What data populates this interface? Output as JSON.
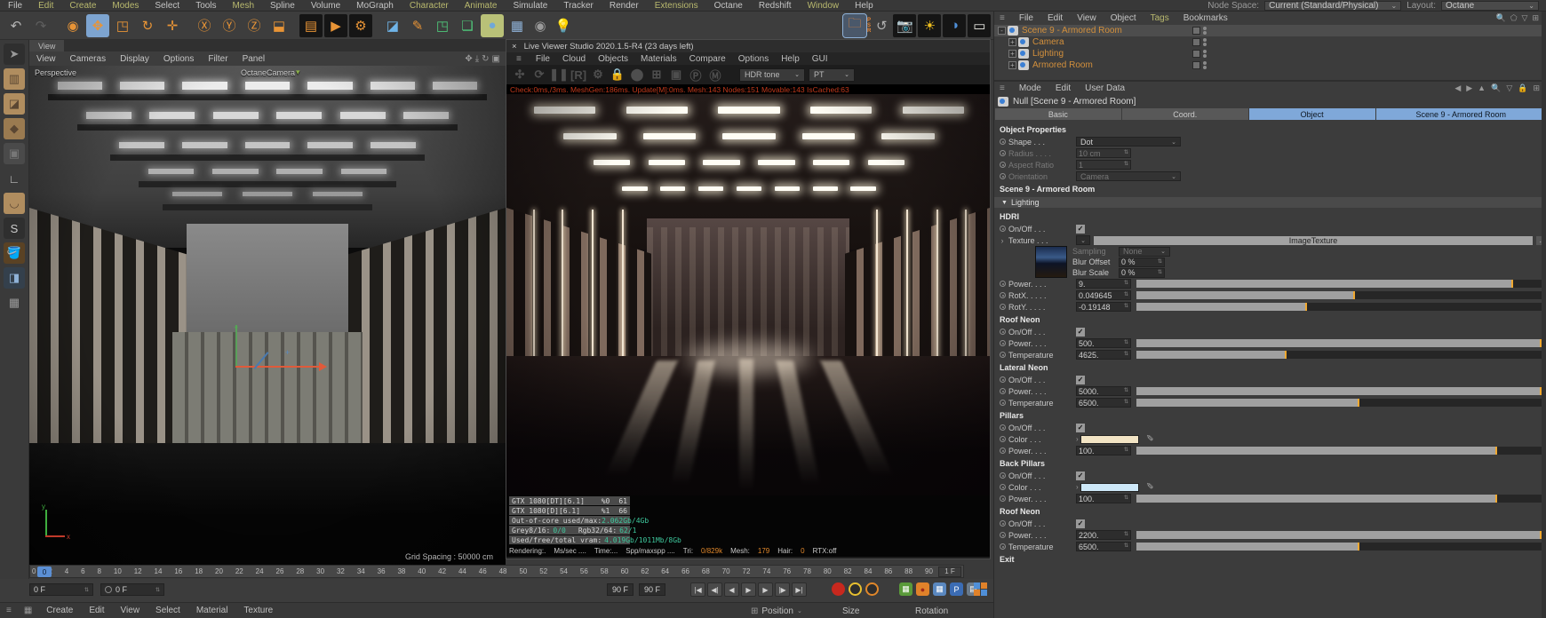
{
  "menu_bar": {
    "items": [
      {
        "label": "File",
        "accent": false
      },
      {
        "label": "Edit",
        "accent": true
      },
      {
        "label": "Create",
        "accent": true
      },
      {
        "label": "Modes",
        "accent": true
      },
      {
        "label": "Select",
        "accent": false
      },
      {
        "label": "Tools",
        "accent": false
      },
      {
        "label": "Mesh",
        "accent": true
      },
      {
        "label": "Spline",
        "accent": false
      },
      {
        "label": "Volume",
        "accent": false
      },
      {
        "label": "MoGraph",
        "accent": false
      },
      {
        "label": "Character",
        "accent": true
      },
      {
        "label": "Animate",
        "accent": true
      },
      {
        "label": "Simulate",
        "accent": false
      },
      {
        "label": "Tracker",
        "accent": false
      },
      {
        "label": "Render",
        "accent": false
      },
      {
        "label": "Extensions",
        "accent": true
      },
      {
        "label": "Octane",
        "accent": false
      },
      {
        "label": "Redshift",
        "accent": false
      },
      {
        "label": "Window",
        "accent": true
      },
      {
        "label": "Help",
        "accent": false
      }
    ],
    "node_space_label": "Node Space:",
    "node_space_value": "Current (Standard/Physical)",
    "layout_label": "Layout:",
    "layout_value": "Octane"
  },
  "toolbar_icons": [
    {
      "name": "undo-icon",
      "glyph": "↶",
      "fg": "#b5b5b5",
      "cls": ""
    },
    {
      "name": "redo-icon",
      "glyph": "↷",
      "fg": "#5e5e5e",
      "cls": ""
    },
    {
      "name": "sep",
      "glyph": "",
      "fg": "",
      "cls": "sep"
    },
    {
      "name": "live-selection-icon",
      "glyph": "◉",
      "fg": "#e89436",
      "cls": ""
    },
    {
      "name": "move-tool-icon",
      "glyph": "✥",
      "fg": "#e89436",
      "cls": "sel"
    },
    {
      "name": "scale-tool-icon",
      "glyph": "◳",
      "fg": "#e89436",
      "cls": ""
    },
    {
      "name": "rotate-tool-icon",
      "glyph": "↻",
      "fg": "#e89436",
      "cls": ""
    },
    {
      "name": "last-tool-icon",
      "glyph": "✛",
      "fg": "#e89436",
      "cls": ""
    },
    {
      "name": "sep",
      "glyph": "",
      "fg": "",
      "cls": "sep"
    },
    {
      "name": "lock-x-axis-icon",
      "glyph": "Ⓧ",
      "fg": "#e89436",
      "cls": ""
    },
    {
      "name": "lock-y-axis-icon",
      "glyph": "Ⓨ",
      "fg": "#e89436",
      "cls": ""
    },
    {
      "name": "lock-z-axis-icon",
      "glyph": "Ⓩ",
      "fg": "#e89436",
      "cls": ""
    },
    {
      "name": "coordinate-system-icon",
      "glyph": "⬓",
      "fg": "#e89436",
      "cls": ""
    },
    {
      "name": "sep",
      "glyph": "",
      "fg": "",
      "cls": "sep"
    },
    {
      "name": "render-view-icon",
      "glyph": "▤",
      "fg": "#e89436",
      "cls": "box"
    },
    {
      "name": "render-picture-viewer-icon",
      "glyph": "▶",
      "fg": "#e89436",
      "cls": "box"
    },
    {
      "name": "render-settings-icon",
      "glyph": "⚙",
      "fg": "#e89436",
      "cls": "box"
    },
    {
      "name": "sep",
      "glyph": "",
      "fg": "",
      "cls": "sep"
    },
    {
      "name": "add-cube-icon",
      "glyph": "◪",
      "fg": "#6fb4e8",
      "cls": ""
    },
    {
      "name": "add-spline-icon",
      "glyph": "✎",
      "fg": "#e89436",
      "cls": ""
    },
    {
      "name": "add-generator-icon",
      "glyph": "◳",
      "fg": "#4fc87a",
      "cls": ""
    },
    {
      "name": "add-deformer-icon",
      "glyph": "❏",
      "fg": "#4fc87a",
      "cls": ""
    },
    {
      "name": "add-environment-icon",
      "glyph": "●",
      "fg": "#6fa8d8",
      "cls": "sel2"
    },
    {
      "name": "add-landscape-icon",
      "glyph": "▦",
      "fg": "#8fb2d8",
      "cls": ""
    },
    {
      "name": "add-camera-icon",
      "glyph": "◉",
      "fg": "#9a9a9a",
      "cls": "small"
    },
    {
      "name": "add-light-icon",
      "glyph": "💡",
      "fg": "#d8d8d8",
      "cls": ""
    },
    {
      "name": "gap300",
      "glyph": "",
      "fg": "",
      "cls": "gap"
    },
    {
      "name": "octane-folder-icon",
      "glyph": "🗀",
      "fg": "#e8883a",
      "cls": "frame"
    },
    {
      "name": "octane-psr-reset-icon",
      "glyph": "PSR",
      "fg": "#e8883a",
      "cls": "psr"
    },
    {
      "name": "octane-reset-icon",
      "glyph": "↺",
      "fg": "#b0b0b0",
      "cls": "small"
    },
    {
      "name": "octane-camera-icon",
      "glyph": "📷",
      "fg": "#d83020",
      "cls": "box"
    },
    {
      "name": "octane-sun-icon",
      "glyph": "☀",
      "fg": "#f0c020",
      "cls": "box"
    },
    {
      "name": "octane-daylight-icon",
      "glyph": "◑",
      "fg": "#4f8fd8",
      "cls": "box"
    },
    {
      "name": "octane-arealight-icon",
      "glyph": "▭",
      "fg": "#f0f0e8",
      "cls": "box"
    },
    {
      "name": "octane-mix-material-icon",
      "glyph": "◍",
      "fg": "#b8c4d0",
      "cls": ""
    },
    {
      "name": "octane-material-icon",
      "glyph": "●",
      "fg": "#b8c4d0",
      "cls": ""
    },
    {
      "name": "octane-shuriken-icon",
      "glyph": "✣",
      "fg": "#3a3a3a",
      "cls": ""
    },
    {
      "name": "octane-pause-icon",
      "glyph": "❚❚",
      "fg": "#2f2f2f",
      "cls": ""
    }
  ],
  "left_palette": [
    {
      "name": "pen-tool-icon",
      "glyph": "➤",
      "fg": "#9a9a9a",
      "bg": "#2f2f2f"
    },
    {
      "name": "modeling-tool-1-icon",
      "glyph": "▥",
      "fg": "#5a4632",
      "bg": "#b08d5f"
    },
    {
      "name": "modeling-tool-2-icon",
      "glyph": "◪",
      "fg": "#5a4632",
      "bg": "#b08d5f"
    },
    {
      "name": "modeling-tool-3-icon",
      "glyph": "◆",
      "fg": "#5a4632",
      "bg": "#9a7a50"
    },
    {
      "name": "modeling-tool-4-icon",
      "glyph": "▣",
      "fg": "#777",
      "bg": "#4a4a4a"
    },
    {
      "name": "axis-tool-icon",
      "glyph": "∟",
      "fg": "#c0c0c0",
      "bg": "#3a3a3a"
    },
    {
      "name": "magnet-tool-icon",
      "glyph": "◡",
      "fg": "#5a4632",
      "bg": "#b08d5f"
    },
    {
      "name": "snap-tool-icon",
      "glyph": "S",
      "fg": "#ccc",
      "bg": "#2f2f2f"
    },
    {
      "name": "paint-tool-icon",
      "glyph": "🪣",
      "fg": "#e8883a",
      "bg": "#5a4224"
    },
    {
      "name": "texture-tool-icon",
      "glyph": "◨",
      "fg": "#8fb2d8",
      "bg": "#34404c"
    },
    {
      "name": "uv-tool-icon",
      "glyph": "▦",
      "fg": "#9a9a9a",
      "bg": "#3a3a3a"
    }
  ],
  "viewport": {
    "tab": "View",
    "menu": [
      "View",
      "Cameras",
      "Display",
      "Options",
      "Filter",
      "Panel"
    ],
    "nav_icons": [
      {
        "name": "pan-view-icon",
        "glyph": "✥"
      },
      {
        "name": "zoom-view-icon",
        "glyph": "⤓"
      },
      {
        "name": "rotate-view-icon",
        "glyph": "↻"
      },
      {
        "name": "toggle-view-icon",
        "glyph": "▣"
      }
    ],
    "projection_label": "Perspective",
    "camera_label": "OctaneCamera",
    "grid_spacing": "Grid Spacing : 50000 cm"
  },
  "live_viewer": {
    "close_glyph": "×",
    "title": "Live Viewer Studio 2020.1.5-R4 (23 days left)",
    "menu": [
      "File",
      "Cloud",
      "Objects",
      "Materials",
      "Compare",
      "Options",
      "Help",
      "GUI"
    ],
    "tool_icons": [
      {
        "name": "octane-kernel-icon",
        "glyph": "✣"
      },
      {
        "name": "restart-render-icon",
        "glyph": "⟳"
      },
      {
        "name": "pause-render-icon",
        "glyph": "❚❚"
      },
      {
        "name": "region-render-icon",
        "glyph": "[R]"
      },
      {
        "name": "render-settings-icon",
        "glyph": "⚙"
      },
      {
        "name": "lock-resolution-icon",
        "glyph": "🔒"
      },
      {
        "name": "film-settings-icon",
        "glyph": "⬤"
      },
      {
        "name": "picture-crop-icon",
        "glyph": "⊞"
      },
      {
        "name": "camera-snapshot-icon",
        "glyph": "▣"
      },
      {
        "name": "pick-focus-icon",
        "glyph": "Ⓟ"
      },
      {
        "name": "pick-material-icon",
        "glyph": "Ⓜ"
      }
    ],
    "hdr_tone_value": "HDR tone",
    "kernel_value": "PT",
    "stats_line": "Check:0ms,/3ms. MeshGen:186ms. Update[M]:0ms. Mesh:143 Nodes:151 Movable:143 IsCached:63",
    "gpu_table": [
      {
        "name": "GTX 1080[DT][6.1]",
        "pct": "%0",
        "temp": "61"
      },
      {
        "name": "GTX 1080[D][6.1]",
        "pct": "%1",
        "temp": "66"
      }
    ],
    "out_of_core_label": "Out-of-core used/max:",
    "out_of_core_value": "2.062Gb/4Gb",
    "grey_label": "Grey8/16:",
    "grey_value": "0/0",
    "rgb_label": "Rgb32/64:",
    "rgb_value": "62/1",
    "vram_label": "Used/free/total vram:",
    "vram_value": "4.019Gb/1011Mb/8Gb",
    "status_segments": [
      {
        "t": "Rendering:.",
        "c": "w"
      },
      {
        "t": "Ms/sec ....",
        "c": "w"
      },
      {
        "t": "Time:...",
        "c": "w"
      },
      {
        "t": "Spp/maxspp ....",
        "c": "w"
      },
      {
        "t": "Tri:",
        "c": "w"
      },
      {
        "t": "0/829k",
        "c": "o"
      },
      {
        "t": "Mesh:",
        "c": "w"
      },
      {
        "t": "179",
        "c": "o"
      },
      {
        "t": "Hair:",
        "c": "w"
      },
      {
        "t": "0",
        "c": "o"
      },
      {
        "t": "RTX:off",
        "c": "w"
      }
    ]
  },
  "object_manager": {
    "menu": [
      {
        "label": "File",
        "accent": false
      },
      {
        "label": "Edit",
        "accent": false
      },
      {
        "label": "View",
        "accent": false
      },
      {
        "label": "Object",
        "accent": false
      },
      {
        "label": "Tags",
        "accent": true
      },
      {
        "label": "Bookmarks",
        "accent": false
      }
    ],
    "corner_icons": [
      {
        "name": "search-icon",
        "glyph": "🔍"
      },
      {
        "name": "path-icon",
        "glyph": "⬠"
      },
      {
        "name": "filter-icon",
        "glyph": "▽"
      },
      {
        "name": "add-layer-icon",
        "glyph": "⊞"
      }
    ],
    "tree": [
      {
        "label": "Scene 9 - Armored Room",
        "indent": 0,
        "selected": true,
        "expander": "-"
      },
      {
        "label": "Camera",
        "indent": 1,
        "selected": false,
        "expander": "+"
      },
      {
        "label": "Lighting",
        "indent": 1,
        "selected": false,
        "expander": "+"
      },
      {
        "label": "Armored Room",
        "indent": 1,
        "selected": false,
        "expander": "+"
      }
    ]
  },
  "attributes": {
    "menu": [
      "Mode",
      "Edit",
      "User Data"
    ],
    "corner_icons": [
      {
        "name": "back-icon",
        "glyph": "◀"
      },
      {
        "name": "forward-icon",
        "glyph": "▶"
      },
      {
        "name": "up-icon",
        "glyph": "▲"
      },
      {
        "name": "search-icon",
        "glyph": "🔍"
      },
      {
        "name": "filter-icon",
        "glyph": "▽"
      },
      {
        "name": "lock-icon",
        "glyph": "🔒"
      },
      {
        "name": "layout-icon",
        "glyph": "⊞"
      }
    ],
    "title": "Null [Scene 9 - Armored Room]",
    "tabs": [
      {
        "label": "Basic",
        "active": false
      },
      {
        "label": "Coord.",
        "active": false
      },
      {
        "label": "Object",
        "active": true
      },
      {
        "label": "Scene 9 - Armored Room",
        "active": true
      }
    ],
    "object_properties_header": "Object Properties",
    "object_properties": [
      {
        "kind": "dropdown",
        "label": "Shape . . .",
        "value": "Dot",
        "disabled": false
      },
      {
        "kind": "spin",
        "label": "Radius . . . .",
        "value": "10 cm",
        "disabled": true
      },
      {
        "kind": "spin",
        "label": "Aspect Ratio",
        "value": "1",
        "disabled": true
      },
      {
        "kind": "dropdown",
        "label": "Orientation",
        "value": "Camera",
        "disabled": true
      }
    ],
    "scene_header": "Scene 9 - Armored Room",
    "lighting_fold": "Lighting",
    "groups": [
      {
        "name": "HDRI",
        "rows": [
          {
            "kind": "checkbox",
            "label": "On/Off . . .",
            "checked": true
          },
          {
            "kind": "texture",
            "label": "Texture . . .",
            "button": "ImageTexture"
          },
          {
            "kind": "hdri_sub",
            "rows": [
              {
                "kind": "dropdown_s",
                "label": "Sampling",
                "value": "None",
                "disabled": true
              },
              {
                "kind": "spin_s",
                "label": "Blur Offset",
                "value": "0 %"
              },
              {
                "kind": "spin_s",
                "label": "Blur Scale",
                "value": "0 %"
              }
            ]
          },
          {
            "kind": "slider",
            "label": "Power. . . .",
            "value": "9.",
            "frac": 0.93
          },
          {
            "kind": "slider",
            "label": "RotX. . . . .",
            "value": "0.049645",
            "frac": 0.54
          },
          {
            "kind": "slider",
            "label": "RotY. . . . .",
            "value": "-0.19148",
            "frac": 0.42
          }
        ]
      },
      {
        "name": "Roof Neon",
        "rows": [
          {
            "kind": "checkbox",
            "label": "On/Off . . .",
            "checked": true
          },
          {
            "kind": "slider",
            "label": "Power. . . .",
            "value": "500.",
            "frac": 1.0
          },
          {
            "kind": "slider",
            "label": "Temperature",
            "value": "4625.",
            "frac": 0.37
          }
        ]
      },
      {
        "name": "Lateral Neon",
        "rows": [
          {
            "kind": "checkbox",
            "label": "On/Off . . .",
            "checked": true
          },
          {
            "kind": "slider",
            "label": "Power. . . .",
            "value": "5000.",
            "frac": 1.0
          },
          {
            "kind": "slider",
            "label": "Temperature",
            "value": "6500.",
            "frac": 0.55
          }
        ]
      },
      {
        "name": "Pillars",
        "rows": [
          {
            "kind": "checkbox",
            "label": "On/Off . . .",
            "checked": true
          },
          {
            "kind": "color",
            "label": "Color . . .",
            "hex": "#f2e4c4"
          },
          {
            "kind": "slider",
            "label": "Power. . . .",
            "value": "100.",
            "frac": 0.89
          }
        ]
      },
      {
        "name": "Back Pillars",
        "rows": [
          {
            "kind": "checkbox",
            "label": "On/Off . . .",
            "checked": true
          },
          {
            "kind": "color",
            "label": "Color . . .",
            "hex": "#cde8f8"
          },
          {
            "kind": "slider",
            "label": "Power. . . .",
            "value": "100.",
            "frac": 0.89
          }
        ]
      },
      {
        "name": "Roof Neon",
        "rows": [
          {
            "kind": "checkbox",
            "label": "On/Off . . .",
            "checked": true
          },
          {
            "kind": "slider",
            "label": "Power. . . .",
            "value": "2200.",
            "frac": 1.0
          },
          {
            "kind": "slider",
            "label": "Temperature",
            "value": "6500.",
            "frac": 0.55
          }
        ]
      },
      {
        "name": "Exit",
        "rows": []
      }
    ]
  },
  "timeline": {
    "ticks": [
      "0",
      "2",
      "4",
      "6",
      "8",
      "10",
      "12",
      "14",
      "16",
      "18",
      "20",
      "22",
      "24",
      "26",
      "28",
      "30",
      "32",
      "34",
      "36",
      "38",
      "40",
      "42",
      "44",
      "46",
      "48",
      "50",
      "52",
      "54",
      "56",
      "58",
      "60",
      "62",
      "64",
      "66",
      "68",
      "70",
      "72",
      "74",
      "76",
      "78",
      "80",
      "82",
      "84",
      "86",
      "88",
      "90"
    ],
    "playhead": "0",
    "end_box": "1 F"
  },
  "transport": {
    "frame_field_1": "0 F",
    "frame_field_2": "0 F",
    "range_start": "90 F",
    "range_end": "90 F",
    "buttons": [
      {
        "name": "goto-start-button",
        "glyph": "|◀"
      },
      {
        "name": "prev-key-button",
        "glyph": "◀|"
      },
      {
        "name": "prev-frame-button",
        "glyph": "◀"
      },
      {
        "name": "play-button",
        "glyph": "▶"
      },
      {
        "name": "next-frame-button",
        "glyph": "▶"
      },
      {
        "name": "next-key-button",
        "glyph": "|▶"
      },
      {
        "name": "goto-end-button",
        "glyph": "▶|"
      }
    ],
    "record_buttons": [
      {
        "name": "record-keyframe-button",
        "style": "background:#c8281e;"
      },
      {
        "name": "autokey-button",
        "style": "background:#2d2d2d;border:2px solid #e8c030;"
      },
      {
        "name": "keyframe-selection-button",
        "style": "background:#2d2d2d;border:2px solid #e0872a;"
      }
    ],
    "manager_buttons": [
      {
        "name": "simulate-button",
        "glyph": "▦",
        "style": "background:#5a9a3a;"
      },
      {
        "name": "dynamics-button",
        "glyph": "●",
        "style": "background:#e0822a;color:#a02a1a;"
      },
      {
        "name": "grid-button",
        "glyph": "▦",
        "style": "background:#5a88c0;"
      },
      {
        "name": "project-button",
        "glyph": "P",
        "style": "background:#3b6cb4;"
      },
      {
        "name": "table-button",
        "glyph": "▤",
        "style": "background:#6a7a8a;"
      }
    ]
  },
  "bottom_bar": {
    "menu": [
      "Create",
      "Edit",
      "View",
      "Select",
      "Material",
      "Texture"
    ],
    "coords": [
      "Position",
      "Size",
      "Rotation"
    ]
  },
  "colors": {
    "accent_orange": "#e89436",
    "selection_blue": "#7fa8d9",
    "tree_orange": "#d3903c",
    "slider_tick": "#f0a830",
    "stat_green": "#3ec89d",
    "stats_red": "#c2391b"
  }
}
